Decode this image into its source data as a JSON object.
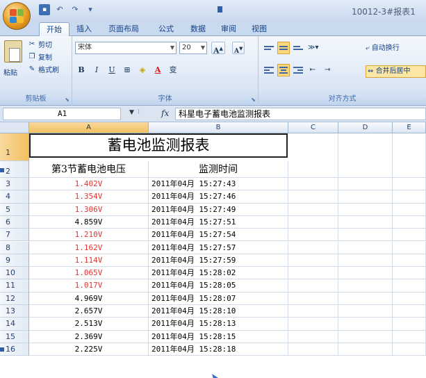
{
  "window": {
    "title": "10012-3#报表1",
    "tabs": [
      "开始",
      "插入",
      "页面布局",
      "公式",
      "数据",
      "审阅",
      "视图"
    ],
    "active_tab": "开始"
  },
  "ribbon": {
    "clipboard": {
      "paste": "粘贴",
      "cut": "剪切",
      "copy": "复制",
      "format_painter": "格式刷",
      "label": "剪贴板"
    },
    "font": {
      "name": "宋体",
      "size": "20",
      "grow": "A",
      "shrink": "A",
      "bold": "B",
      "italic": "I",
      "underline": "U",
      "phonetic": "变",
      "label": "字体"
    },
    "alignment": {
      "wrap_text": "自动换行",
      "merge_center": "合并后居中",
      "label": "对齐方式"
    }
  },
  "formula_bar": {
    "cell_ref": "A1",
    "fx": "fx",
    "content": "科星电子蓄电池监测报表"
  },
  "sheet": {
    "columns": [
      "A",
      "B",
      "C",
      "D",
      "E"
    ],
    "title": "蓄电池监测报表",
    "header_voltage": "第3节蓄电池电压",
    "header_time": "监测时间",
    "rows": [
      {
        "n": "1"
      },
      {
        "n": "2"
      },
      {
        "n": "3",
        "v": "1.402V",
        "t": "2011年04月 15:27:43",
        "alert": true
      },
      {
        "n": "4",
        "v": "1.354V",
        "t": "2011年04月 15:27:46",
        "alert": true
      },
      {
        "n": "5",
        "v": "1.306V",
        "t": "2011年04月 15:27:49",
        "alert": true
      },
      {
        "n": "6",
        "v": "4.859V",
        "t": "2011年04月 15:27:51",
        "alert": false
      },
      {
        "n": "7",
        "v": "1.210V",
        "t": "2011年04月 15:27:54",
        "alert": true
      },
      {
        "n": "8",
        "v": "1.162V",
        "t": "2011年04月 15:27:57",
        "alert": true
      },
      {
        "n": "9",
        "v": "1.114V",
        "t": "2011年04月 15:27:59",
        "alert": true
      },
      {
        "n": "10",
        "v": "1.065V",
        "t": "2011年04月 15:28:02",
        "alert": true
      },
      {
        "n": "11",
        "v": "1.017V",
        "t": "2011年04月 15:28:05",
        "alert": true
      },
      {
        "n": "12",
        "v": "4.969V",
        "t": "2011年04月 15:28:07",
        "alert": false
      },
      {
        "n": "13",
        "v": "2.657V",
        "t": "2011年04月 15:28:10",
        "alert": false
      },
      {
        "n": "14",
        "v": "2.513V",
        "t": "2011年04月 15:28:13",
        "alert": false
      },
      {
        "n": "15",
        "v": "2.369V",
        "t": "2011年04月 15:28:15",
        "alert": false
      },
      {
        "n": "16",
        "v": "2.225V",
        "t": "2011年04月 15:28:18",
        "alert": false
      }
    ]
  },
  "colors": {
    "alert_text": "#e8322e",
    "normal_text": "#000000",
    "selection": "#f1c15f",
    "ribbon_blue": "#15428b"
  }
}
